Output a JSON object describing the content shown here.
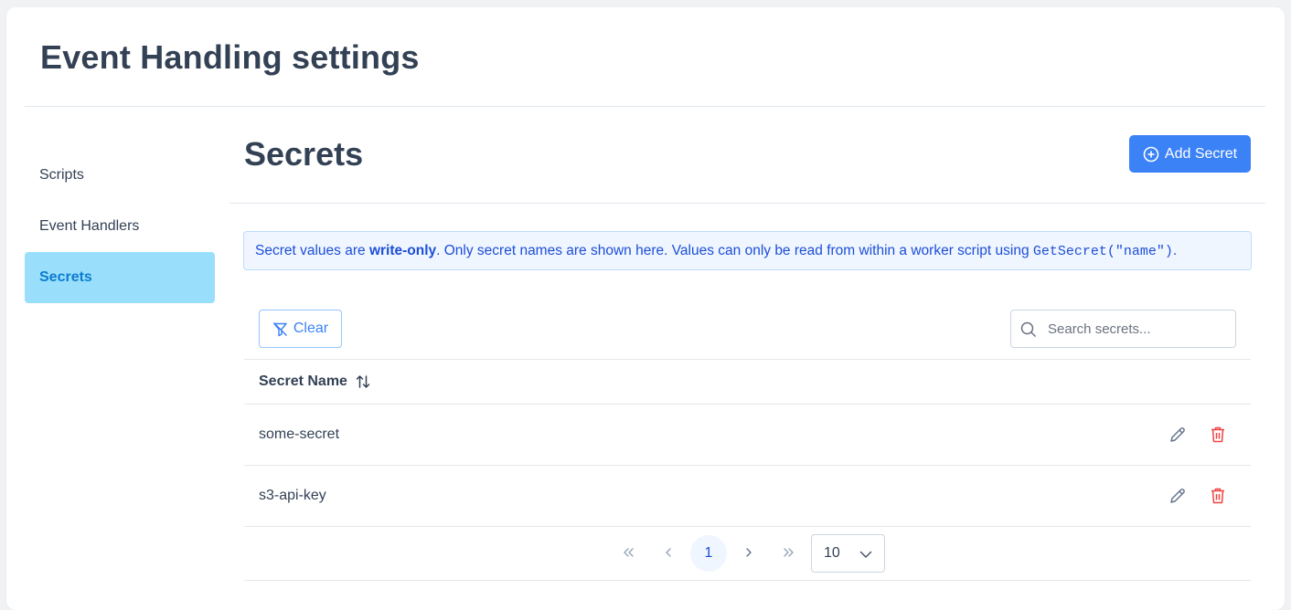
{
  "header": {
    "title": "Event Handling settings"
  },
  "sidebar": {
    "items": [
      {
        "label": "Scripts",
        "active": false
      },
      {
        "label": "Event Handlers",
        "active": false
      },
      {
        "label": "Secrets",
        "active": true
      }
    ]
  },
  "section": {
    "title": "Secrets",
    "add_button_label": "Add Secret"
  },
  "info": {
    "prefix": "Secret values are ",
    "bold": "write-only",
    "middle": ". Only secret names are shown here. Values can only be read from within a worker script using ",
    "code": "GetSecret(\"name\")",
    "suffix": "."
  },
  "toolbar": {
    "clear_label": "Clear",
    "search_placeholder": "Search secrets..."
  },
  "table": {
    "column_header": "Secret Name",
    "rows": [
      {
        "name": "some-secret"
      },
      {
        "name": "s3-api-key"
      }
    ]
  },
  "pagination": {
    "current_page": "1",
    "rows_per_page": "10"
  },
  "colors": {
    "primary": "#3b82f6",
    "active_nav_bg": "#99dffc",
    "danger": "#ef4444"
  }
}
